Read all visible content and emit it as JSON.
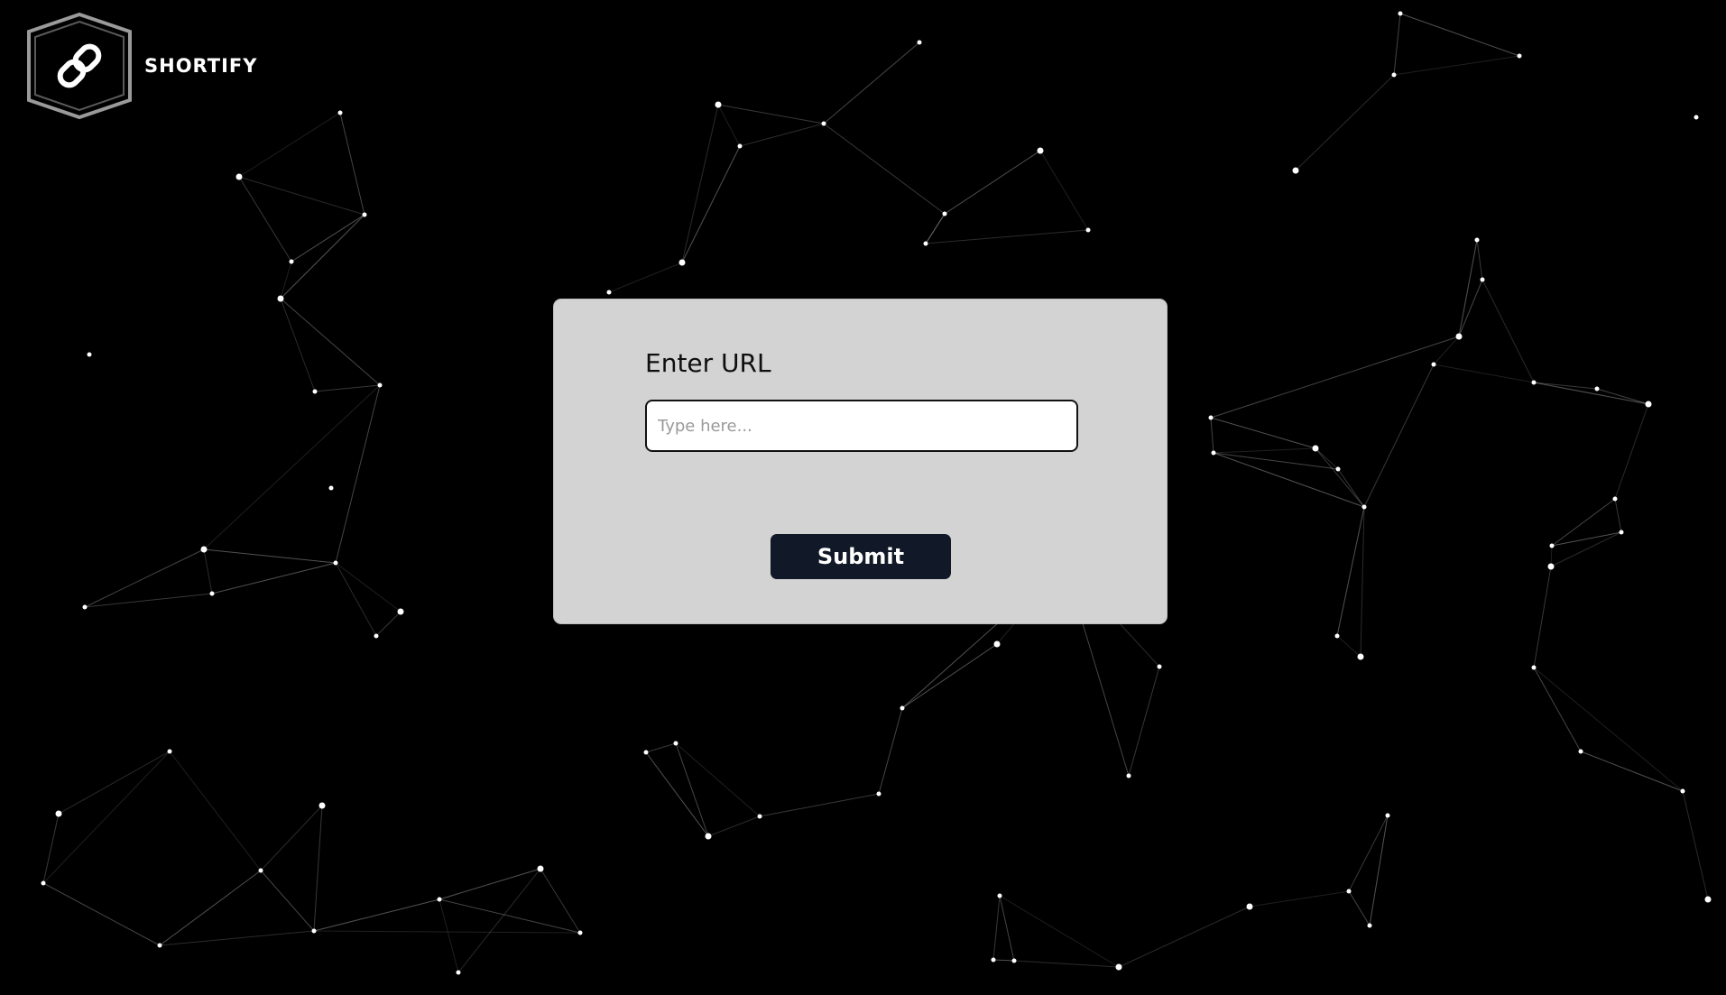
{
  "brand": {
    "name": "SHORTIFY",
    "logo_icon": "chain-link-icon"
  },
  "form": {
    "title": "Enter URL",
    "input_value": "",
    "input_placeholder": "Type here...",
    "submit_label": "Submit"
  },
  "colors": {
    "background": "#000000",
    "card": "#d3d3d3",
    "button": "#111827",
    "particle": "#ffffff"
  }
}
